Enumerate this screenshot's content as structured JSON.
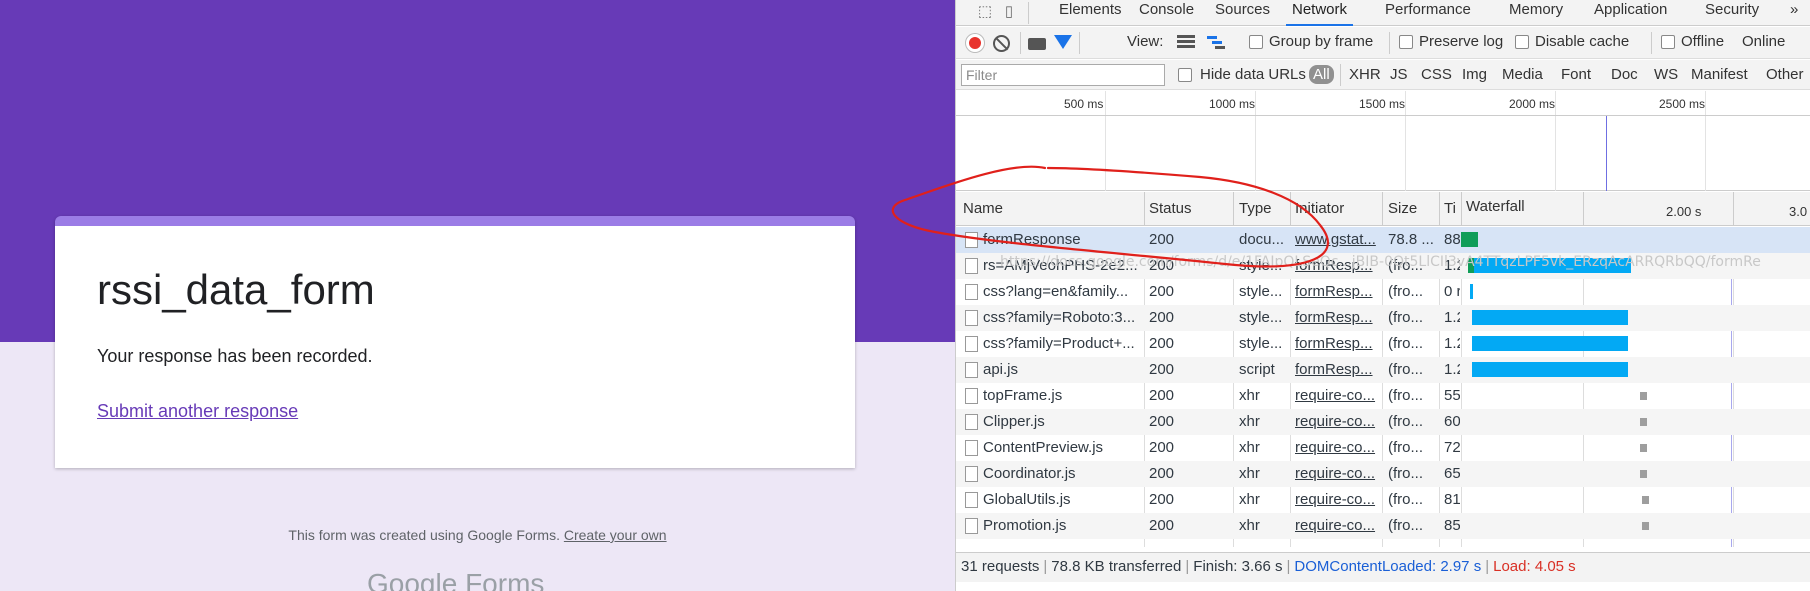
{
  "form": {
    "title": "rssi_data_form",
    "message": "Your response has been recorded.",
    "submit_another": "Submit another response",
    "footer_text": "This form was created using Google Forms.",
    "footer_link": "Create your own",
    "logo": "Google Forms"
  },
  "devtools": {
    "tabs": [
      "Elements",
      "Console",
      "Sources",
      "Network",
      "Performance",
      "Memory",
      "Application",
      "Security"
    ],
    "more_tabs": "»",
    "toolbar": {
      "view_label": "View:",
      "group_by_frame": "Group by frame",
      "preserve_log": "Preserve log",
      "disable_cache": "Disable cache",
      "offline": "Offline",
      "throttle": "Online"
    },
    "filter": {
      "placeholder": "Filter",
      "hide_data_urls": "Hide data URLs",
      "types": [
        "All",
        "XHR",
        "JS",
        "CSS",
        "Img",
        "Media",
        "Font",
        "Doc",
        "WS",
        "Manifest",
        "Other"
      ]
    },
    "overview_ticks": [
      "500 ms",
      "1000 ms",
      "1500 ms",
      "2000 ms",
      "2500 ms"
    ],
    "columns": [
      "Name",
      "Status",
      "Type",
      "Initiator",
      "Size",
      "Ti",
      "Waterfall"
    ],
    "waterfall_ticks": [
      "2.00 s",
      "3.0"
    ],
    "url_overlay": "https://docs.google.com/forms/d/e/1FAIpQLSeQc...jBIB-0Qt5LlCIl3vA4TTqzLPF5vk_ERzqAcARRQRbQQ/formRe",
    "rows": [
      {
        "name": "formResponse",
        "status": "200",
        "type": "docu...",
        "initiator": "www.gstat...",
        "size": "78.8 ...",
        "time": "88"
      },
      {
        "name": "rs=AMjVeohPHS-2e2...",
        "status": "200",
        "type": "style...",
        "initiator": "formResp...",
        "size": "(fro...",
        "time": "1.2"
      },
      {
        "name": "css?lang=en&family...",
        "status": "200",
        "type": "style...",
        "initiator": "formResp...",
        "size": "(fro...",
        "time": "0 r"
      },
      {
        "name": "css?family=Roboto:3...",
        "status": "200",
        "type": "style...",
        "initiator": "formResp...",
        "size": "(fro...",
        "time": "1.2"
      },
      {
        "name": "css?family=Product+...",
        "status": "200",
        "type": "style...",
        "initiator": "formResp...",
        "size": "(fro...",
        "time": "1.2"
      },
      {
        "name": "api.js",
        "status": "200",
        "type": "script",
        "initiator": "formResp...",
        "size": "(fro...",
        "time": "1.2"
      },
      {
        "name": "topFrame.js",
        "status": "200",
        "type": "xhr",
        "initiator": "require-co...",
        "size": "(fro...",
        "time": "55"
      },
      {
        "name": "Clipper.js",
        "status": "200",
        "type": "xhr",
        "initiator": "require-co...",
        "size": "(fro...",
        "time": "60"
      },
      {
        "name": "ContentPreview.js",
        "status": "200",
        "type": "xhr",
        "initiator": "require-co...",
        "size": "(fro...",
        "time": "72"
      },
      {
        "name": "Coordinator.js",
        "status": "200",
        "type": "xhr",
        "initiator": "require-co...",
        "size": "(fro...",
        "time": "65"
      },
      {
        "name": "GlobalUtils.js",
        "status": "200",
        "type": "xhr",
        "initiator": "require-co...",
        "size": "(fro...",
        "time": "81"
      },
      {
        "name": "Promotion.js",
        "status": "200",
        "type": "xhr",
        "initiator": "require-co...",
        "size": "(fro...",
        "time": "85"
      }
    ],
    "status_bar": {
      "requests": "31 requests",
      "transferred": "78.8 KB transferred",
      "finish": "Finish: 3.66 s",
      "dom_content_loaded": "DOMContentLoaded: 2.97 s",
      "load": "Load: 4.05 s"
    },
    "colors": {
      "accent": "#1a73e8",
      "waterfall_bar": "#03a9f4",
      "waterfall_ttfb": "#0f9d58",
      "annotation": "#e0201b",
      "form_band": "#673ab7"
    }
  }
}
